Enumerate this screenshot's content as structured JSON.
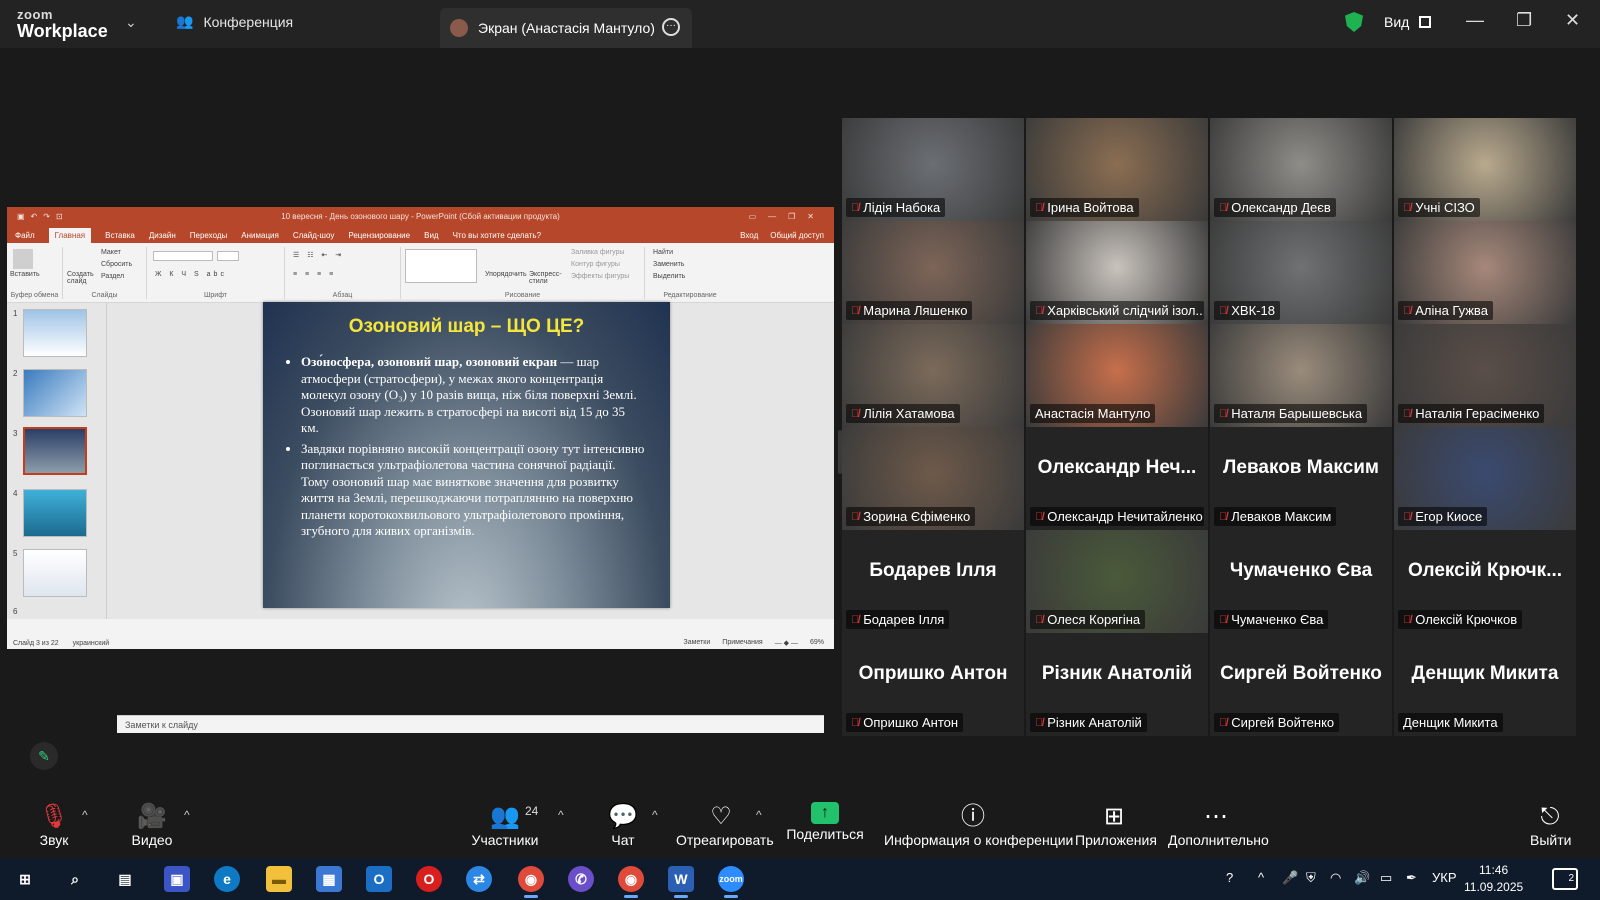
{
  "app": {
    "brand_top": "zoom",
    "brand_bottom": "Workplace",
    "conference_tab": "Конференция",
    "screen_tab": "Экран (Анастасія Мантуло)",
    "view_label": "Вид"
  },
  "ppt": {
    "window_title": "10 вересня - День озонового шару - PowerPoint (Сбой активации продукта)",
    "menu": [
      "Файл",
      "Главная",
      "Вставка",
      "Дизайн",
      "Переходы",
      "Анимация",
      "Слайд-шоу",
      "Рецензирование",
      "Вид",
      "Что вы хотите сделать?"
    ],
    "menu_right": [
      "Вход",
      "Общий доступ"
    ],
    "ribbon_groups": [
      "Буфер обмена",
      "Слайды",
      "Шрифт",
      "Абзац",
      "Рисование",
      "Редактирование"
    ],
    "ribbon_buttons": {
      "paste": "Вставить",
      "create_slide": "Создать слайд",
      "layout": "Макет",
      "reset": "Сбросить",
      "section": "Раздел",
      "arrange": "Упорядочить",
      "express_styles": "Экспресс-стили",
      "shape_fill": "Заливка фигуры",
      "shape_outline": "Контур фигуры",
      "shape_effects": "Эффекты фигуры",
      "find": "Найти",
      "replace": "Заменить",
      "select": "Выделить"
    },
    "slide_numbers": [
      "1",
      "2",
      "3",
      "4",
      "5",
      "6"
    ],
    "selected_slide": 3,
    "slide": {
      "title": "Озоновий шар – ЩО ЦЕ?",
      "bullet1_bold": "Озо́носфера, озоновий шар, озоновий екран",
      "bullet1_rest": " — шар атмосфери (стратосфери), у межах якого концентрація молекул озону (O₃) у 10 разів вища, ніж біля поверхні Землі. Озоновий шар лежить в стратосфері на висоті від 15 до 35 км.",
      "bullet2": "Завдяки порівняно високій концентрації озону тут інтенсивно поглинається ультрафіолетова частина сонячної радіації. Тому озоновий шар має виняткове значення для розвитку життя на Землі, перешкоджаючи потраплянню на поверхню планети коротокохвильового ультрафіолетового проміння, згубного для живих організмів."
    },
    "notes_placeholder": "Заметки к слайду",
    "status_slide": "Слайд 3 из 22",
    "status_lang": "украинский",
    "status_notes": "Заметки",
    "status_comments": "Примечания",
    "zoom": "69%"
  },
  "participants": [
    {
      "name": "Лідія Набока",
      "video": true,
      "muted": true
    },
    {
      "name": "Ірина Войтова",
      "video": true,
      "muted": true
    },
    {
      "name": "Олександр Деєв",
      "video": true,
      "muted": true
    },
    {
      "name": "Учні СІЗО",
      "video": true,
      "muted": true
    },
    {
      "name": "Марина Ляшенко",
      "video": true,
      "muted": true
    },
    {
      "name": "Харківський слідчий ізол...",
      "video": true,
      "muted": true
    },
    {
      "name": "ХВК-18",
      "video": true,
      "muted": true
    },
    {
      "name": "Аліна Гужва",
      "video": true,
      "muted": true
    },
    {
      "name": "Лілія Хатамова",
      "video": true,
      "muted": true
    },
    {
      "name": "Анастасія Мантуло",
      "video": true,
      "muted": false,
      "active": true
    },
    {
      "name": "Наталя Барышевська",
      "video": true,
      "muted": true
    },
    {
      "name": "Наталія Герасіменко",
      "video": true,
      "muted": true
    },
    {
      "name": "Зорина Єфіменко",
      "video": true,
      "muted": true
    },
    {
      "name": "Олександр Нечитайленко",
      "big": "Олександр Неч...",
      "video": false,
      "muted": true
    },
    {
      "name": "Леваков Максим",
      "big": "Леваков Максим",
      "video": false,
      "muted": true
    },
    {
      "name": "Егор Киосе",
      "video": true,
      "muted": true
    },
    {
      "name": "Бодарев Ілля",
      "big": "Бодарев Ілля",
      "video": false,
      "muted": true
    },
    {
      "name": "Олеся Корягіна",
      "video": true,
      "muted": true
    },
    {
      "name": "Чумаченко Єва",
      "big": "Чумаченко Єва",
      "video": false,
      "muted": true
    },
    {
      "name": "Олексій Крючков",
      "big": "Олексій Крючк...",
      "video": false,
      "muted": true
    },
    {
      "name": "Опришко Антон",
      "big": "Опришко Антон",
      "video": false,
      "muted": true
    },
    {
      "name": "Різник Анатолій",
      "big": "Різник Анатолій",
      "video": false,
      "muted": true
    },
    {
      "name": "Сиргей Войтенко",
      "big": "Сиргей Войтенко",
      "video": false,
      "muted": true
    },
    {
      "name": "Денщик Микита",
      "big": "Денщик Микита",
      "video": false,
      "muted": false
    }
  ],
  "toolbar": {
    "audio": "Звук",
    "video": "Видео",
    "participants": "Участники",
    "participants_count": "24",
    "chat": "Чат",
    "react": "Отреагировать",
    "share": "Поделиться",
    "info": "Информация о конференции",
    "apps": "Приложения",
    "more": "Дополнительно",
    "leave": "Выйти"
  },
  "taskbar": {
    "lang": "УКР",
    "time": "11:46",
    "date": "11.09.2025",
    "notifications": "2"
  }
}
